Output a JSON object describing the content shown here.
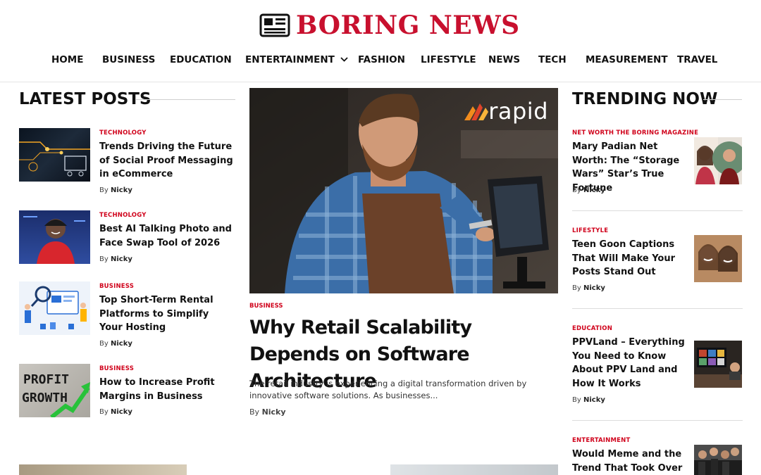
{
  "site": {
    "logo_text": "BORING NEWS",
    "brand_color": "#c8102e"
  },
  "nav": {
    "items": [
      {
        "label": "HOME"
      },
      {
        "label": "BUSINESS"
      },
      {
        "label": "EDUCATION"
      },
      {
        "label": "ENTERTAINMENT"
      },
      {
        "label": "FASHION"
      },
      {
        "label": "LIFESTYLE"
      },
      {
        "label": "NEWS"
      },
      {
        "label": "TECH"
      },
      {
        "label": "MEASUREMENT"
      },
      {
        "label": "TRAVEL"
      }
    ],
    "dropdown_icon": "chevron-down-icon"
  },
  "latest": {
    "heading": "LATEST POSTS",
    "posts": [
      {
        "category": "TECHNOLOGY",
        "title": "Trends Driving the Future of Social Proof Messaging in eCommerce",
        "by": "By",
        "author": "Nicky"
      },
      {
        "category": "TECHNOLOGY",
        "title": "Best AI Talking Photo and Face Swap Tool of 2026",
        "by": "By",
        "author": "Nicky"
      },
      {
        "category": "BUSINESS",
        "title": "Top Short-Term Rental Platforms to Simplify Your Hosting",
        "by": "By",
        "author": "Nicky"
      },
      {
        "category": "BUSINESS",
        "title": "How to Increase Profit Margins in Business",
        "by": "By",
        "author": "Nicky"
      }
    ]
  },
  "feature": {
    "image_logo": "rapid",
    "category": "BUSINESS",
    "title": "Why Retail Scalability Depends on Software Architecture",
    "excerpt": "The retail industry is experiencing a digital transformation driven by innovative software solutions. As businesses...",
    "by": "By",
    "author": "Nicky"
  },
  "trending": {
    "heading": "TRENDING NOW",
    "posts": [
      {
        "category": "NET WORTH THE BORING MAGAZINE",
        "title": "Mary Padian Net Worth: The “Storage Wars” Star’s True Fortune",
        "by": "By",
        "author": "Nicky"
      },
      {
        "category": "LIFESTYLE",
        "title": "Teen Goon Captions That Will Make Your Posts Stand Out",
        "by": "By",
        "author": "Nicky"
      },
      {
        "category": "EDUCATION",
        "title": "PPVLand – Everything You Need to Know About PPV Land and How It Works",
        "by": "By",
        "author": "Nicky"
      },
      {
        "category": "ENTERTAINMENT",
        "title": "Would Meme and the Trend That Took Over the",
        "by": "",
        "author": ""
      }
    ]
  }
}
